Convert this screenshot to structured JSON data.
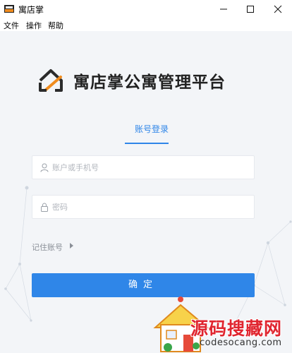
{
  "window": {
    "app_icon": "brand-logo-icon",
    "title": "寓店掌",
    "controls": [
      "minimize-icon",
      "maximize-icon",
      "close-icon"
    ]
  },
  "menu": {
    "items": [
      "文件",
      "操作",
      "帮助"
    ]
  },
  "login": {
    "logo_icon": "house-logo-icon",
    "brand_title": "寓店掌公寓管理平台",
    "tab_label": "账号登录",
    "username": {
      "icon": "user-icon",
      "placeholder": "账户或手机号",
      "value": ""
    },
    "password": {
      "icon": "lock-icon",
      "placeholder": "密码",
      "value": ""
    },
    "remember_label": "记住账号",
    "confirm_label": "确定"
  },
  "watermark": {
    "title": "源码搜藏网",
    "url": "codesocang.com"
  },
  "colors": {
    "accent": "#2f86e8",
    "background": "#f3f5f8",
    "logo_orange": "#f08c1e",
    "logo_dark": "#2b2b2b",
    "watermark_red": "#e0252f"
  }
}
